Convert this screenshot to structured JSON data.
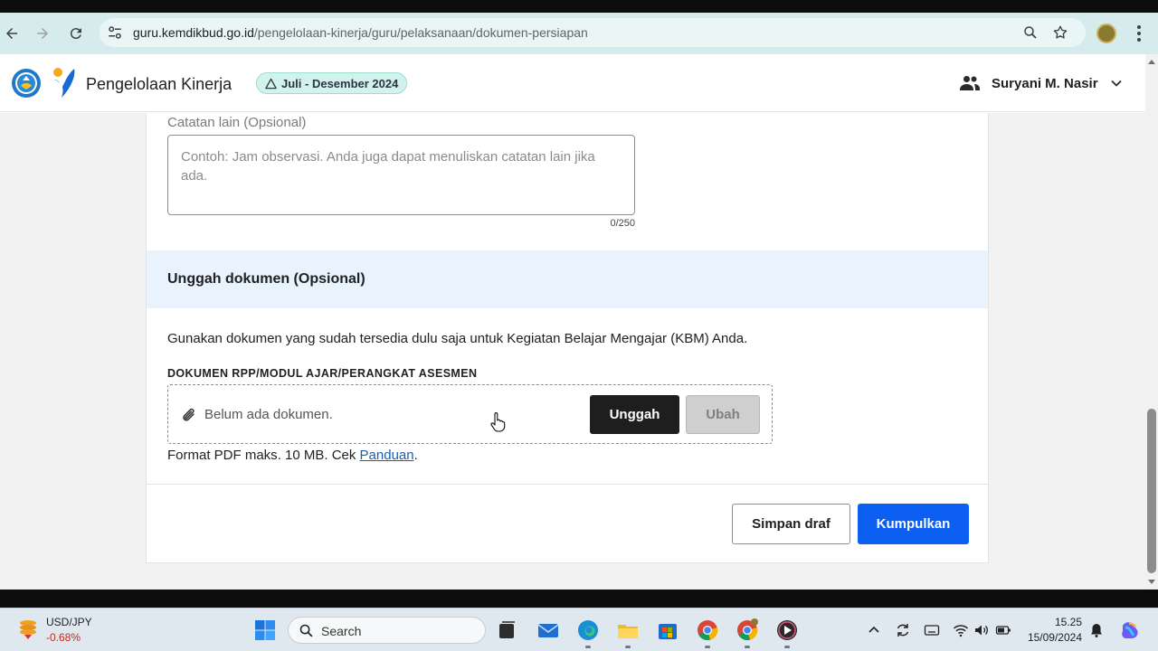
{
  "browser": {
    "url_host": "guru.kemdikbud.go.id",
    "url_path": "/pengelolaan-kinerja/guru/pelaksanaan/dokumen-persiapan"
  },
  "header": {
    "app_title": "Pengelolaan Kinerja",
    "period_badge": "Juli - Desember 2024",
    "user_name": "Suryani M. Nasir"
  },
  "form": {
    "notes_label": "Catatan lain (Opsional)",
    "notes_placeholder": "Contoh: Jam observasi. Anda juga dapat menuliskan catatan lain jika ada.",
    "notes_value": "",
    "char_count": "0/250",
    "upload_section_title": "Unggah dokumen (Opsional)",
    "upload_description": "Gunakan dokumen yang sudah tersedia dulu saja untuk Kegiatan Belajar Mengajar (KBM) Anda.",
    "document_label": "DOKUMEN RPP/MODUL AJAR/PERANGKAT ASESMEN",
    "no_document_text": "Belum ada dokumen.",
    "upload_button": "Unggah",
    "change_button": "Ubah",
    "format_note_prefix": "Format PDF maks. 10 MB. Cek ",
    "format_note_link": "Panduan",
    "format_note_suffix": ".",
    "save_draft_button": "Simpan draf",
    "submit_button": "Kumpulkan"
  },
  "taskbar": {
    "widget_name": "USD/JPY",
    "widget_value": "-0.68%",
    "search_placeholder": "Search",
    "time": "15.25",
    "date": "15/09/2024"
  },
  "colors": {
    "primary_button": "#0c5ff0",
    "upload_button": "#1e1e1e",
    "section_header_bg": "#e9f3fd",
    "badge_bg": "#d2f3ec",
    "link": "#1a5fb4",
    "widget_negative": "#c42b1c"
  },
  "icons": [
    "back-icon",
    "forward-icon",
    "reload-icon",
    "site-info-icon",
    "zoom-icon",
    "bookmark-star-icon",
    "profile-avatar",
    "chrome-menu-icon",
    "kemdikbud-logo",
    "merdeka-logo",
    "warning-triangle-icon",
    "people-icon",
    "chevron-down-icon",
    "paperclip-icon",
    "hand-cursor-icon",
    "windows-start-icon",
    "search-icon",
    "file-explorer-icon",
    "mail-icon",
    "edge-icon",
    "folder-icon",
    "store-icon",
    "chrome-icon",
    "media-player-icon",
    "notification-bell-icon",
    "copilot-icon"
  ]
}
